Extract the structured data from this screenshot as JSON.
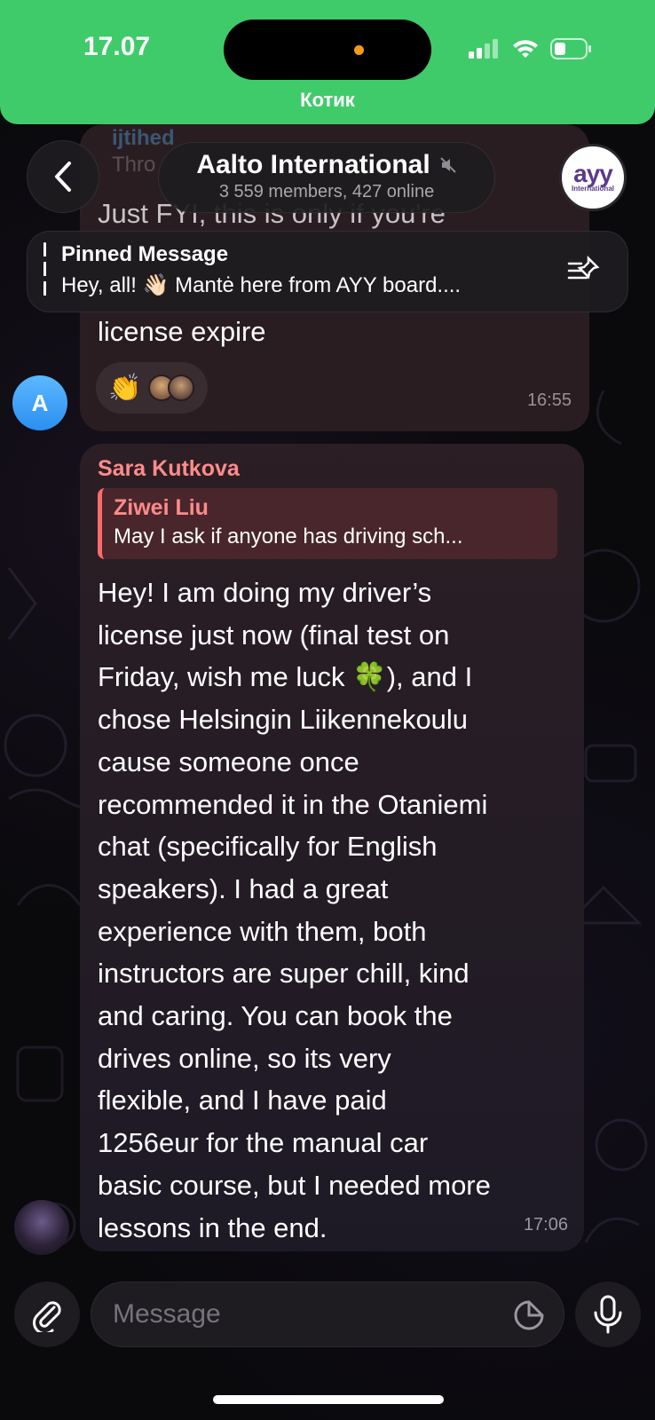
{
  "status_bar": {
    "time": "17.07",
    "call_label": "Котик",
    "accent_color": "#3fcb6a"
  },
  "header": {
    "title": "Aalto International",
    "subtitle": "3 559 members, 427 online",
    "muted_icon": "speaker-muted-icon",
    "group_avatar": {
      "logo_text": "ayy",
      "logo_sub": "International"
    }
  },
  "pinned": {
    "title": "Pinned Message",
    "text": "Hey, all! 👋🏻 Mantė here from AYY board...."
  },
  "messages": [
    {
      "ghost_sender": "ijtihed",
      "ghost_reply": "Thro",
      "text_hidden": "Just FYI, this is only if you're",
      "last_line": "license expire",
      "reactions": [
        {
          "emoji": "👏",
          "count_avatars": 2
        }
      ],
      "time": "16:55",
      "sender_avatar_letter": "A",
      "avatar_color": "#3a9bf5"
    },
    {
      "sender": "Sara Kutkova",
      "sender_color": "#ff8b8b",
      "reply": {
        "name": "Ziwei Liu",
        "text": "May I ask if anyone has driving sch..."
      },
      "body_lines": [
        "Hey! I am doing my driver’s",
        "license just now (final test on",
        "Friday, wish me luck 🍀), and I",
        "chose Helsingin Liikennekoulu",
        "cause someone once",
        "recommended it in the Otaniemi",
        "chat (specifically for English",
        "speakers). I had a great",
        "experience with them, both",
        "instructors are super chill, kind",
        "and caring. You can book the",
        "drives online, so its very",
        "flexible, and I have paid",
        "1256eur for the manual car",
        "basic course, but I needed more",
        "lessons in the end."
      ],
      "time": "17:06"
    }
  ],
  "composer": {
    "placeholder": "Message",
    "attach_icon": "paperclip-icon",
    "sticker_icon": "sticker-icon",
    "mic_icon": "microphone-icon"
  }
}
